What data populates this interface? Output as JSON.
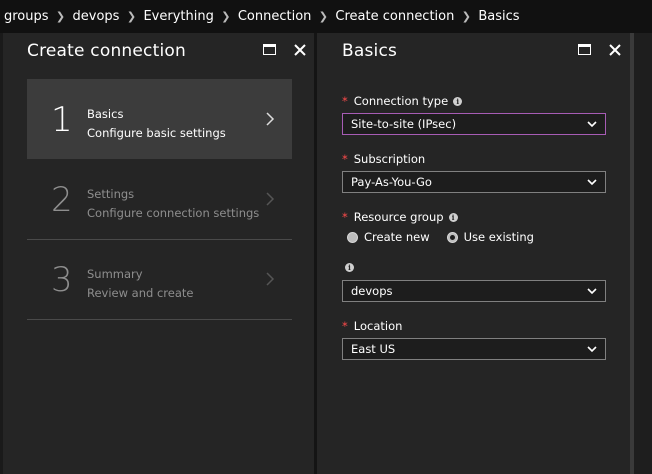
{
  "breadcrumb": [
    "groups",
    "devops",
    "Everything",
    "Connection",
    "Create connection",
    "Basics"
  ],
  "left_blade": {
    "title": "Create connection",
    "steps": [
      {
        "number": "1",
        "title": "Basics",
        "subtitle": "Configure basic settings",
        "state": "active"
      },
      {
        "number": "2",
        "title": "Settings",
        "subtitle": "Configure connection settings",
        "state": "disabled"
      },
      {
        "number": "3",
        "title": "Summary",
        "subtitle": "Review and create",
        "state": "disabled"
      }
    ]
  },
  "right_blade": {
    "title": "Basics",
    "fields": {
      "connection_type": {
        "label": "Connection type",
        "required": true,
        "value": "Site-to-site (IPsec)"
      },
      "subscription": {
        "label": "Subscription",
        "required": true,
        "value": "Pay-As-You-Go"
      },
      "resource_group": {
        "label": "Resource group",
        "required": true,
        "options": [
          "Create new",
          "Use existing"
        ],
        "selected": "Use existing",
        "value": "devops"
      },
      "location": {
        "label": "Location",
        "required": true,
        "value": "East US"
      }
    }
  },
  "icons": {
    "maximize": "maximize-icon",
    "close": "close-icon",
    "chevron": "chevron-icon",
    "info": "info-icon"
  },
  "colors": {
    "focus_border": "#a75cb5",
    "required": "#ff4b4b",
    "active_step": "#3c3c3c"
  }
}
